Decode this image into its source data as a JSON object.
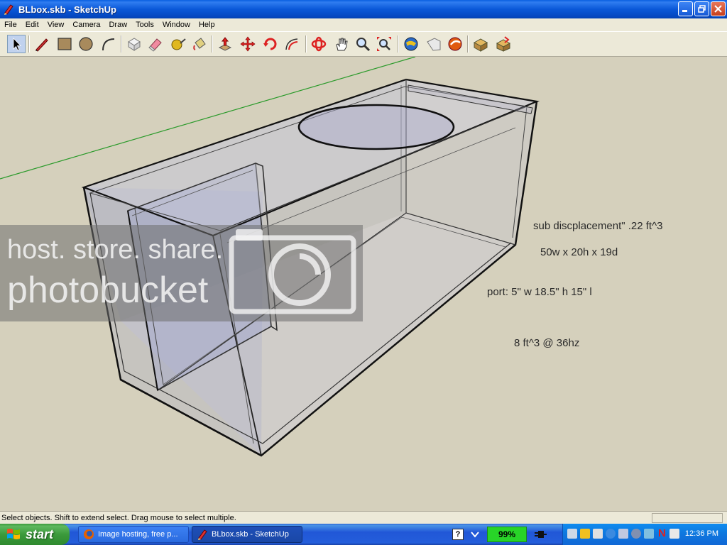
{
  "window": {
    "title": "BLbox.skb - SketchUp",
    "controls": [
      "minimize",
      "maximize",
      "close"
    ]
  },
  "menu": [
    "File",
    "Edit",
    "View",
    "Camera",
    "Draw",
    "Tools",
    "Window",
    "Help"
  ],
  "toolbar": {
    "tools": [
      {
        "name": "select-tool-icon",
        "active": true
      },
      {
        "name": "pencil-tool-icon"
      },
      {
        "name": "rectangle-tool-icon"
      },
      {
        "name": "circle-tool-icon"
      },
      {
        "name": "arc-tool-icon"
      },
      {
        "name": "make-component-icon"
      },
      {
        "name": "eraser-tool-icon"
      },
      {
        "name": "tape-measure-icon"
      },
      {
        "name": "paint-bucket-icon"
      },
      {
        "name": "push-pull-icon"
      },
      {
        "name": "move-tool-icon"
      },
      {
        "name": "rotate-tool-icon"
      },
      {
        "name": "offset-tool-icon"
      },
      {
        "name": "orbit-tool-icon"
      },
      {
        "name": "pan-tool-icon"
      },
      {
        "name": "zoom-tool-icon"
      },
      {
        "name": "zoom-extents-icon"
      },
      {
        "name": "get-current-view-icon"
      },
      {
        "name": "place-model-icon"
      },
      {
        "name": "share-model-icon"
      },
      {
        "name": "get-models-icon"
      },
      {
        "name": "share-component-icon"
      }
    ]
  },
  "viewport": {
    "notes": {
      "displacement": "sub discplacement\" .22 ft^3",
      "dimensions": "50w x 20h x 19d",
      "port": "port: 5\" w 18.5\" h 15\" l",
      "tuning": "8 ft^3 @ 36hz"
    },
    "watermark": {
      "line1": "host. store. share.",
      "line2": "photobucket"
    }
  },
  "status": {
    "text": "Select objects. Shift to extend select. Drag mouse to select multiple."
  },
  "taskbar": {
    "start_label": "start",
    "tasks": [
      {
        "label": "Image hosting, free p...",
        "active": false
      },
      {
        "label": "BLbox.skb - SketchUp",
        "active": true
      }
    ],
    "help_label": "?",
    "battery": "99%",
    "clock": "12:36 PM"
  }
}
